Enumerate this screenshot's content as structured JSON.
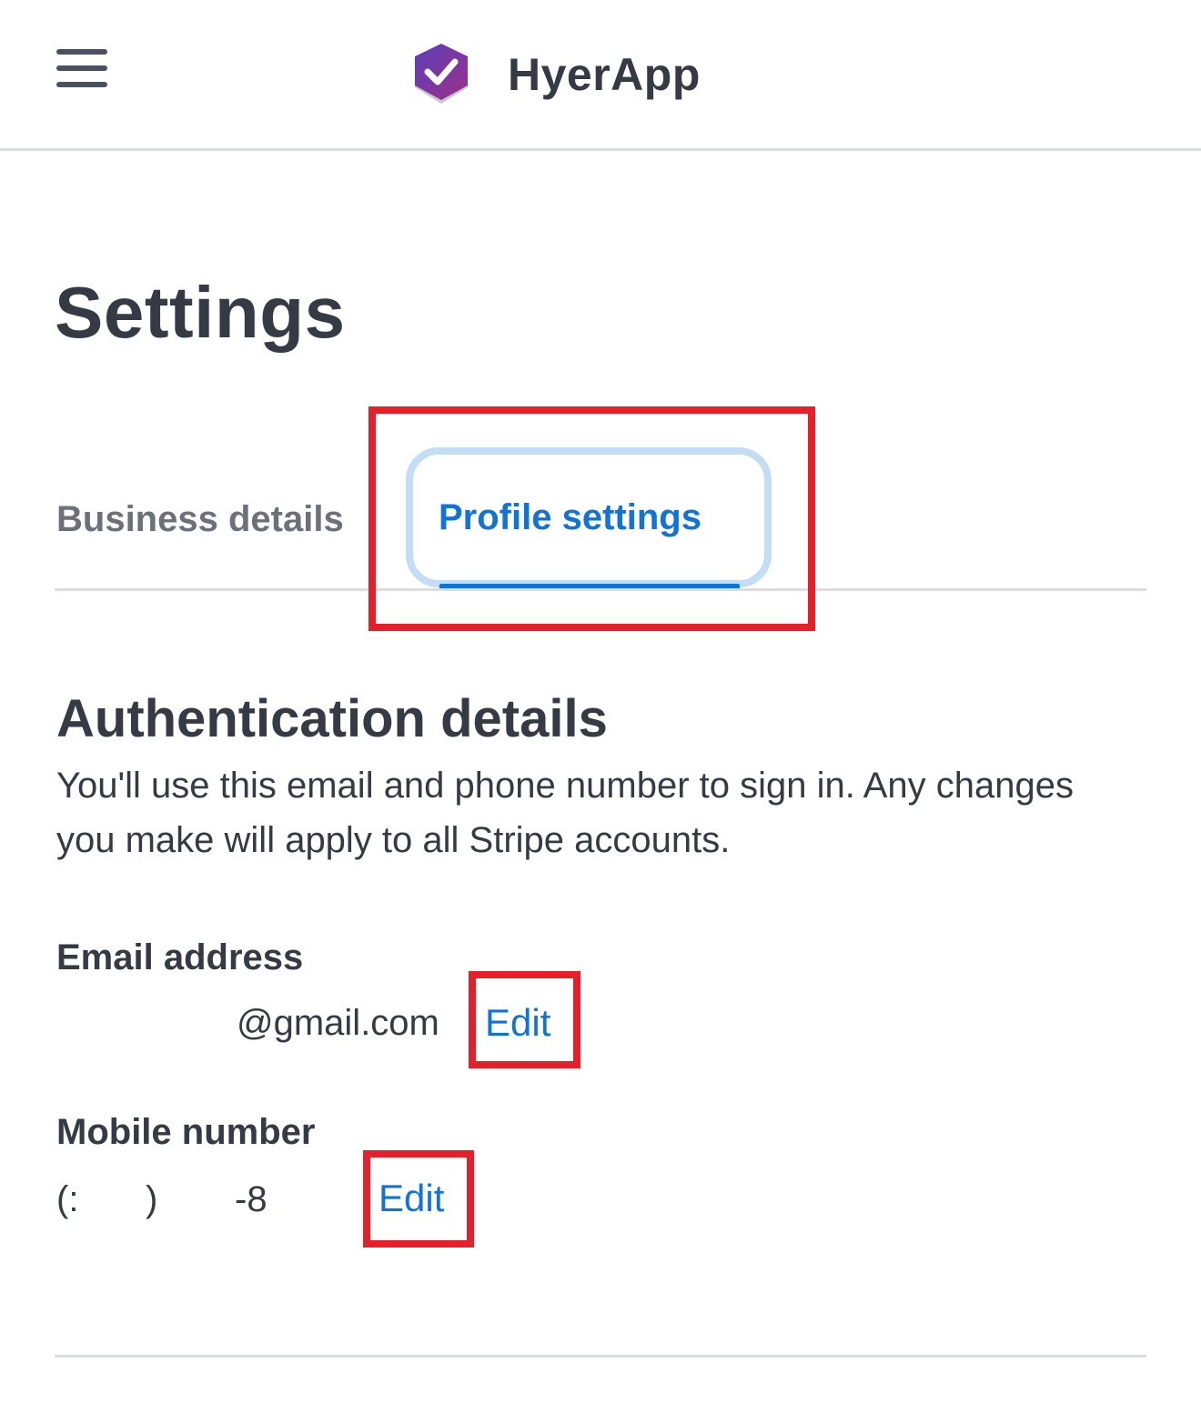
{
  "header": {
    "app_name": "HyerApp",
    "menu_icon": "hamburger-menu-icon",
    "logo_icon": "hyerapp-logo-icon"
  },
  "page": {
    "title": "Settings"
  },
  "tabs": [
    {
      "label": "Business details",
      "active": false
    },
    {
      "label": "Profile settings",
      "active": true
    }
  ],
  "section": {
    "title": "Authentication details",
    "description": "You'll use this email and phone number to sign in. Any changes you make will apply to all Stripe accounts."
  },
  "fields": {
    "email": {
      "label": "Email address",
      "value": "@gmail.com",
      "edit_label": "Edit"
    },
    "mobile": {
      "label": "Mobile number",
      "value_parts": [
        "(:",
        ")",
        "-8"
      ],
      "edit_label": "Edit"
    }
  },
  "colors": {
    "accent": "#0f73d9",
    "text": "#353a44",
    "muted": "#6c7079",
    "focus_ring": "#c3ddf5",
    "annotation": "#e5202a"
  }
}
